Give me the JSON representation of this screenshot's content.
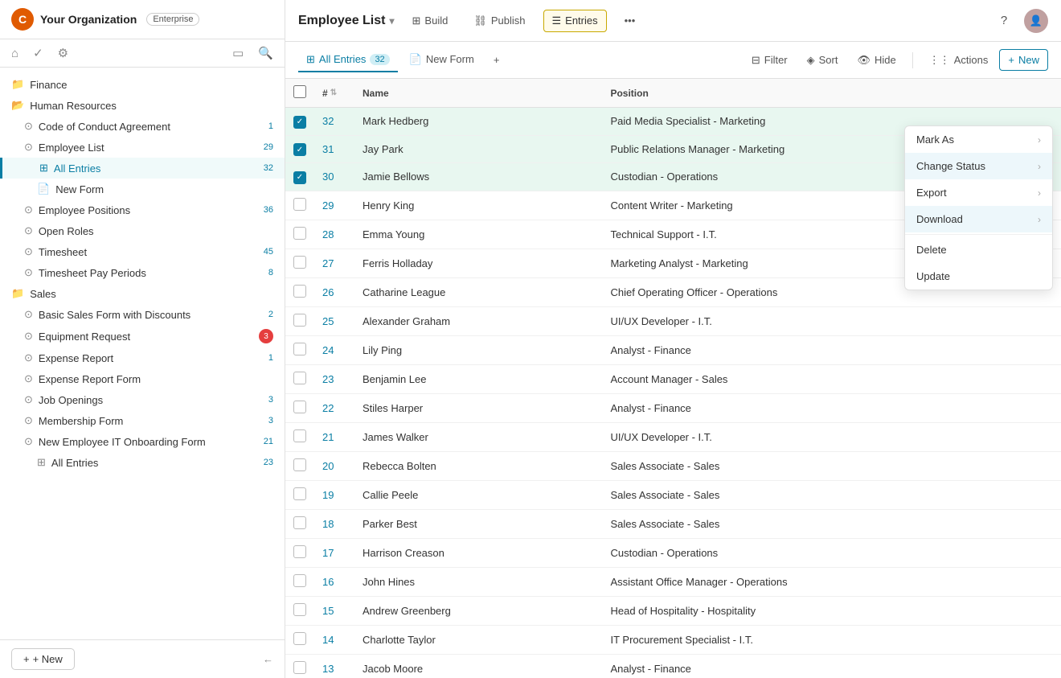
{
  "sidebar": {
    "org_name": "Your Organization",
    "org_badge": "Enterprise",
    "nav_items": [
      {
        "id": "finance",
        "label": "Finance",
        "type": "folder",
        "indent": 0
      },
      {
        "id": "human-resources",
        "label": "Human Resources",
        "type": "folder",
        "indent": 0
      },
      {
        "id": "code-of-conduct",
        "label": "Code of Conduct Agreement",
        "type": "form",
        "indent": 1,
        "badge": "1"
      },
      {
        "id": "employee-list",
        "label": "Employee List",
        "type": "form",
        "indent": 1,
        "badge": "29"
      },
      {
        "id": "all-entries",
        "label": "All Entries",
        "type": "table",
        "indent": 2,
        "badge": "32",
        "active": true
      },
      {
        "id": "new-form",
        "label": "New Form",
        "type": "form",
        "indent": 2
      },
      {
        "id": "employee-positions",
        "label": "Employee Positions",
        "type": "form",
        "indent": 1,
        "badge": "36"
      },
      {
        "id": "open-roles",
        "label": "Open Roles",
        "type": "form",
        "indent": 1
      },
      {
        "id": "timesheet",
        "label": "Timesheet",
        "type": "form",
        "indent": 1,
        "badge": "45"
      },
      {
        "id": "timesheet-pay-periods",
        "label": "Timesheet Pay Periods",
        "type": "form",
        "indent": 1,
        "badge": "8"
      },
      {
        "id": "sales",
        "label": "Sales",
        "type": "folder",
        "indent": 0
      },
      {
        "id": "basic-sales",
        "label": "Basic Sales Form with Discounts",
        "type": "form",
        "indent": 1,
        "badge": "2"
      },
      {
        "id": "equipment-request",
        "label": "Equipment Request",
        "type": "form",
        "indent": 1,
        "badge_red": "3"
      },
      {
        "id": "expense-report",
        "label": "Expense Report",
        "type": "form",
        "indent": 1,
        "badge": "1"
      },
      {
        "id": "expense-report-form",
        "label": "Expense Report Form",
        "type": "form",
        "indent": 1
      },
      {
        "id": "job-openings",
        "label": "Job Openings",
        "type": "form",
        "indent": 1,
        "badge": "3"
      },
      {
        "id": "membership-form",
        "label": "Membership Form",
        "type": "form",
        "indent": 1,
        "badge": "3"
      },
      {
        "id": "new-employee-it",
        "label": "New Employee IT Onboarding Form",
        "type": "form",
        "indent": 1,
        "badge": "21"
      },
      {
        "id": "all-entries-2",
        "label": "All Entries",
        "type": "table",
        "indent": 2,
        "badge": "23"
      }
    ],
    "new_button_label": "+ New",
    "footer_arrow": "←"
  },
  "topbar": {
    "title": "Employee List",
    "nav_items": [
      {
        "label": "Build",
        "icon": "⊞"
      },
      {
        "label": "Publish",
        "icon": "⛓"
      },
      {
        "label": "Entries",
        "icon": "☰",
        "active": true
      }
    ],
    "more_icon": "•••"
  },
  "toolbar": {
    "tab_label": "All Entries",
    "tab_count": "32",
    "new_form_label": "New Form",
    "add_icon": "+",
    "filter_label": "Filter",
    "sort_label": "Sort",
    "hide_label": "Hide",
    "actions_label": "Actions",
    "new_label": "New"
  },
  "table": {
    "columns": [
      "Name",
      "Position"
    ],
    "rows": [
      {
        "num": 32,
        "name": "Mark Hedberg",
        "position": "Paid Media Specialist - Marketing",
        "checked": true
      },
      {
        "num": 31,
        "name": "Jay Park",
        "position": "Public Relations Manager - Marketing",
        "checked": true
      },
      {
        "num": 30,
        "name": "Jamie Bellows",
        "position": "Custodian - Operations",
        "checked": true
      },
      {
        "num": 29,
        "name": "Henry King",
        "position": "Content Writer - Marketing",
        "checked": false
      },
      {
        "num": 28,
        "name": "Emma Young",
        "position": "Technical Support - I.T.",
        "checked": false
      },
      {
        "num": 27,
        "name": "Ferris Holladay",
        "position": "Marketing Analyst - Marketing",
        "checked": false
      },
      {
        "num": 26,
        "name": "Catharine League",
        "position": "Chief Operating Officer - Operations",
        "checked": false
      },
      {
        "num": 25,
        "name": "Alexander Graham",
        "position": "UI/UX Developer - I.T.",
        "checked": false
      },
      {
        "num": 24,
        "name": "Lily Ping",
        "position": "Analyst - Finance",
        "checked": false
      },
      {
        "num": 23,
        "name": "Benjamin Lee",
        "position": "Account Manager - Sales",
        "checked": false
      },
      {
        "num": 22,
        "name": "Stiles Harper",
        "position": "Analyst - Finance",
        "checked": false
      },
      {
        "num": 21,
        "name": "James Walker",
        "position": "UI/UX Developer - I.T.",
        "checked": false
      },
      {
        "num": 20,
        "name": "Rebecca Bolten",
        "position": "Sales Associate - Sales",
        "checked": false
      },
      {
        "num": 19,
        "name": "Callie Peele",
        "position": "Sales Associate - Sales",
        "checked": false
      },
      {
        "num": 18,
        "name": "Parker Best",
        "position": "Sales Associate - Sales",
        "checked": false
      },
      {
        "num": 17,
        "name": "Harrison Creason",
        "position": "Custodian - Operations",
        "checked": false
      },
      {
        "num": 16,
        "name": "John Hines",
        "position": "Assistant Office Manager - Operations",
        "checked": false
      },
      {
        "num": 15,
        "name": "Andrew Greenberg",
        "position": "Head of Hospitality - Hospitality",
        "checked": false
      },
      {
        "num": 14,
        "name": "Charlotte Taylor",
        "position": "IT Procurement Specialist - I.T.",
        "checked": false
      },
      {
        "num": 13,
        "name": "Jacob Moore",
        "position": "Analyst - Finance",
        "checked": false
      }
    ]
  },
  "actions_dropdown": {
    "items": [
      {
        "label": "Mark As",
        "has_arrow": true
      },
      {
        "label": "Change Status",
        "has_arrow": true,
        "active": true
      },
      {
        "label": "Export",
        "has_arrow": true
      },
      {
        "label": "Download",
        "has_arrow": true,
        "active": true
      },
      {
        "label": "Delete",
        "has_arrow": false
      },
      {
        "label": "Update",
        "has_arrow": false
      }
    ]
  }
}
